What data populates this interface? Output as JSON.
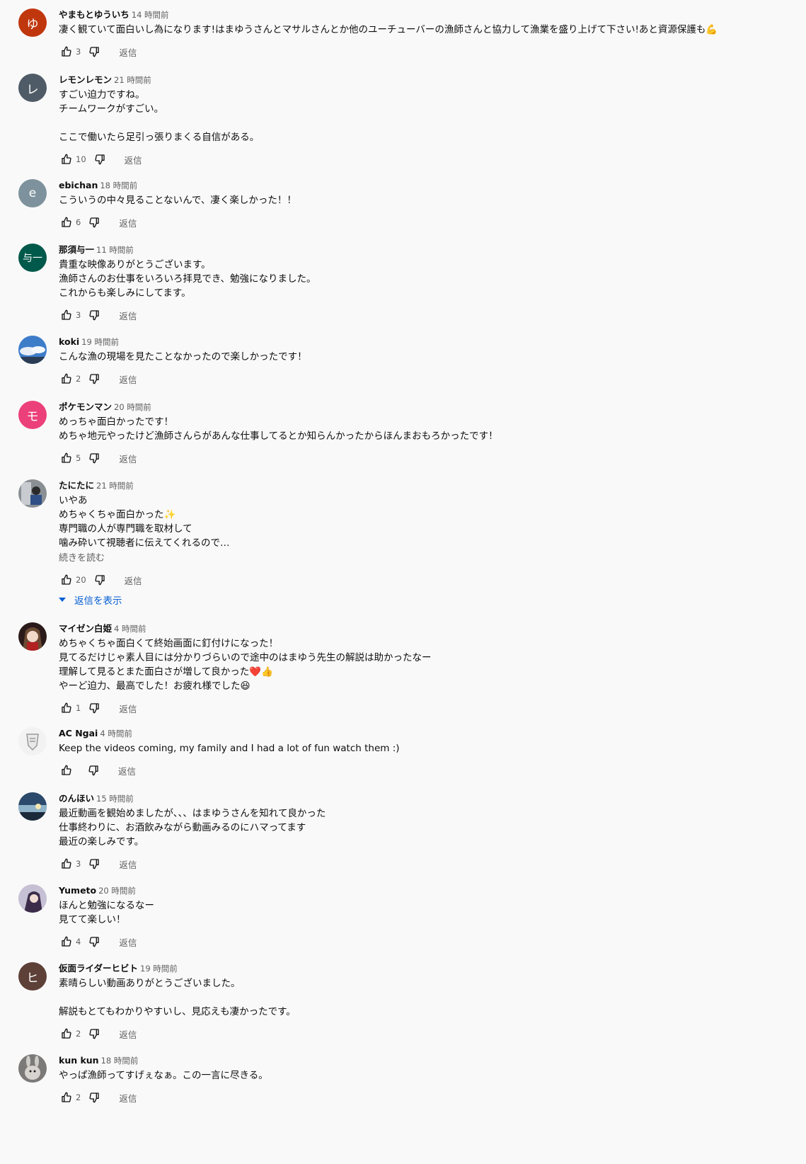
{
  "reply_label": "返信",
  "comments": [
    {
      "author": "やまもとゆういち",
      "time": "14 時間前",
      "avatar": {
        "type": "letter",
        "letter": "ゆ",
        "color": "#c0370e"
      },
      "lines": [
        "凄く観ていて面白いし為になります!はまゆうさんとマサルさんとか他のユーチューバーの漁師さんと協力して漁業を盛り上げて下さい!あと資源保護も💪"
      ],
      "likes": "3"
    },
    {
      "author": "レモンレモン",
      "time": "21 時間前",
      "avatar": {
        "type": "letter",
        "letter": "レ",
        "color": "#4f5b66"
      },
      "lines": [
        "すごい迫力ですね。",
        "チームワークがすごい。",
        "",
        "ここで働いたら足引っ張りまくる自信がある。"
      ],
      "likes": "10"
    },
    {
      "author": "ebichan",
      "time": "18 時間前",
      "avatar": {
        "type": "letter",
        "letter": "e",
        "color": "#7d929c"
      },
      "lines": [
        "こういうの中々見ることないんで、凄く楽しかった！！"
      ],
      "likes": "6"
    },
    {
      "author": "那須与一",
      "time": "11 時間前",
      "avatar": {
        "type": "letter",
        "letter": "与一",
        "color": "#00594a"
      },
      "lines": [
        "貴重な映像ありがとうございます。",
        "漁師さんのお仕事をいろいろ拝見でき、勉強になりました。",
        "これからも楽しみにしてます。"
      ],
      "likes": "3"
    },
    {
      "author": "koki",
      "time": "19 時間前",
      "avatar": {
        "type": "image",
        "image": "sky-clouds-photo"
      },
      "lines": [
        "こんな漁の現場を見たことなかったので楽しかったです！"
      ],
      "likes": "2"
    },
    {
      "author": "ポケモンマン",
      "time": "20 時間前",
      "avatar": {
        "type": "letter",
        "letter": "モ",
        "color": "#ec407a"
      },
      "lines": [
        "めっちゃ面白かったです！",
        "めちゃ地元やったけど漁師さんらがあんな仕事してるとか知らんかったからほんまおもろかったです！"
      ],
      "likes": "5"
    },
    {
      "author": "たにたに",
      "time": "21 時間前",
      "avatar": {
        "type": "image",
        "image": "person-photo"
      },
      "lines": [
        "いやあ",
        "めちゃくちゃ面白かった✨",
        "専門職の人が専門職を取材して",
        "噛み砕いて視聴者に伝えてくれるので…"
      ],
      "read_more": "続きを読む",
      "likes": "20",
      "replies_toggle": "返信を表示"
    },
    {
      "author": "マイゼン白姫",
      "time": "4 時間前",
      "avatar": {
        "type": "image",
        "image": "anime-character"
      },
      "lines": [
        "めちゃくちゃ面白くて終始画面に釘付けになった！",
        "見てるだけじゃ素人目には分かりづらいので途中のはまゆう先生の解説は助かったなー",
        "理解して見るとまた面白さが増して良かった❤️👍",
        "やーど迫力、最高でした！お疲れ様でした😆"
      ],
      "likes": "1"
    },
    {
      "author": "AC Ngai",
      "time": "4 時間前",
      "avatar": {
        "type": "image",
        "image": "shield-logo"
      },
      "lines": [
        "Keep the videos coming, my family and I had a lot of fun watch them :)"
      ],
      "likes": ""
    },
    {
      "author": "のんほい",
      "time": "15 時間前",
      "avatar": {
        "type": "image",
        "image": "sunset-sky-photo"
      },
      "lines": [
        "最近動画を観始めましたが、、、はまゆうさんを知れて良かった",
        "仕事終わりに、お酒飲みながら動画みるのにハマってます",
        "最近の楽しみです。"
      ],
      "likes": "3"
    },
    {
      "author": "Yumeto",
      "time": "20 時間前",
      "avatar": {
        "type": "image",
        "image": "anime-avatar"
      },
      "lines": [
        "ほんと勉強になるなー",
        "見てて楽しい！"
      ],
      "likes": "4"
    },
    {
      "author": "仮面ライダーヒビト",
      "time": "19 時間前",
      "avatar": {
        "type": "letter",
        "letter": "ヒ",
        "color": "#5d4037"
      },
      "lines": [
        "素晴らしい動画ありがとうございました。",
        "",
        "解説もとてもわかりやすいし、見応えも凄かったです。"
      ],
      "likes": "2"
    },
    {
      "author": "kun kun",
      "time": "18 時間前",
      "avatar": {
        "type": "image",
        "image": "rabbit-photo"
      },
      "lines": [
        "やっぱ漁師ってすげぇなぁ。この一言に尽きる。"
      ],
      "likes": "2"
    }
  ]
}
